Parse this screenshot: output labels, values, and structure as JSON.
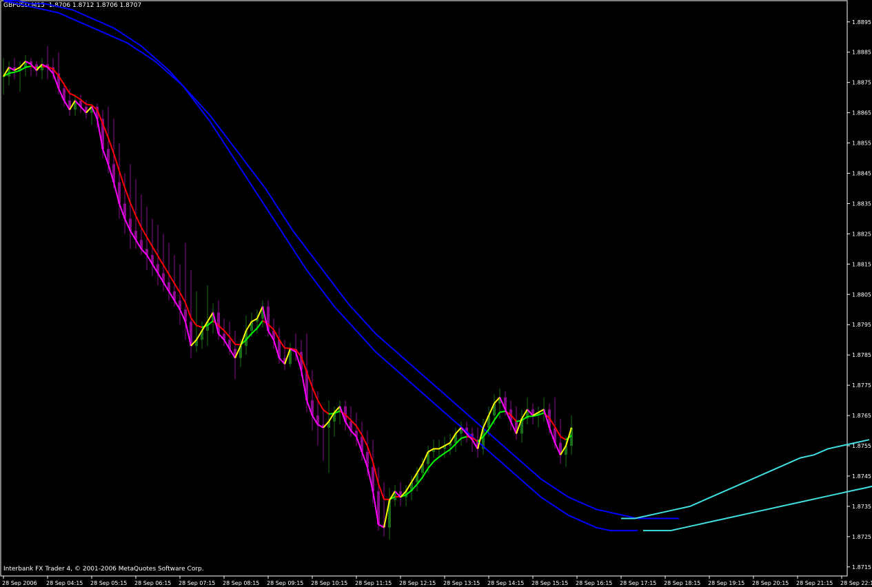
{
  "header": {
    "symbol": "GBPUSD,M15",
    "ohlc": "1.8706 1.8712 1.8706 1.8707"
  },
  "footer": {
    "copyright": "Interbank FX Trader 4, © 2001-2006 MetaQuotes Software Corp."
  },
  "colors": {
    "background": "#000000",
    "frame": "#ffffff",
    "bull_candle": "#1a6e1a",
    "bear_candle": "#8b0a8b",
    "ma_slow_primary": "#0000ff",
    "ma_slow_secondary": "#40e0e0",
    "ma_fast_down": "#ff0000",
    "ma_fast_up": "#00ff00",
    "trend_up": "#ffff00",
    "trend_down": "#ff00ff"
  },
  "chart_data": {
    "type": "line",
    "instrument": "GBPUSD",
    "timeframe": "M15",
    "ylim": [
      1.8712,
      1.8902
    ],
    "y_ticks": [
      "1.8895",
      "1.8885",
      "1.8875",
      "1.8865",
      "1.8855",
      "1.8845",
      "1.8835",
      "1.8825",
      "1.8815",
      "1.8805",
      "1.8795",
      "1.8785",
      "1.8775",
      "1.8765",
      "1.8755",
      "1.8745",
      "1.8735",
      "1.8725",
      "1.8715"
    ],
    "x_ticks": [
      {
        "bar": 0,
        "label": "28 Sep 2006"
      },
      {
        "bar": 8,
        "label": "28 Sep 04:15"
      },
      {
        "bar": 16,
        "label": "28 Sep 05:15"
      },
      {
        "bar": 24,
        "label": "28 Sep 06:15"
      },
      {
        "bar": 32,
        "label": "28 Sep 07:15"
      },
      {
        "bar": 40,
        "label": "28 Sep 08:15"
      },
      {
        "bar": 48,
        "label": "28 Sep 09:15"
      },
      {
        "bar": 56,
        "label": "28 Sep 10:15"
      },
      {
        "bar": 64,
        "label": "28 Sep 11:15"
      },
      {
        "bar": 72,
        "label": "28 Sep 12:15"
      },
      {
        "bar": 80,
        "label": "28 Sep 13:15"
      },
      {
        "bar": 88,
        "label": "28 Sep 14:15"
      },
      {
        "bar": 96,
        "label": "28 Sep 15:15"
      },
      {
        "bar": 104,
        "label": "28 Sep 16:15"
      },
      {
        "bar": 112,
        "label": "28 Sep 17:15"
      },
      {
        "bar": 120,
        "label": "28 Sep 18:15"
      },
      {
        "bar": 128,
        "label": "28 Sep 19:15"
      },
      {
        "bar": 136,
        "label": "28 Sep 20:15"
      },
      {
        "bar": 144,
        "label": "28 Sep 21:15"
      },
      {
        "bar": 152,
        "label": "28 Sep 22:15"
      }
    ],
    "candles": [
      {
        "o": 1.8877,
        "h": 1.8883,
        "l": 1.8871,
        "c": 1.8877
      },
      {
        "o": 1.8877,
        "h": 1.8882,
        "l": 1.8874,
        "c": 1.888
      },
      {
        "o": 1.888,
        "h": 1.8883,
        "l": 1.8876,
        "c": 1.8879
      },
      {
        "o": 1.8879,
        "h": 1.8882,
        "l": 1.8872,
        "c": 1.888
      },
      {
        "o": 1.888,
        "h": 1.8884,
        "l": 1.8877,
        "c": 1.8882
      },
      {
        "o": 1.8882,
        "h": 1.8883,
        "l": 1.8877,
        "c": 1.8881
      },
      {
        "o": 1.8881,
        "h": 1.8882,
        "l": 1.8877,
        "c": 1.8879
      },
      {
        "o": 1.8879,
        "h": 1.8883,
        "l": 1.8876,
        "c": 1.8881
      },
      {
        "o": 1.8881,
        "h": 1.8887,
        "l": 1.8876,
        "c": 1.888
      },
      {
        "o": 1.888,
        "h": 1.8883,
        "l": 1.8876,
        "c": 1.8878
      },
      {
        "o": 1.8878,
        "h": 1.8885,
        "l": 1.8871,
        "c": 1.8873
      },
      {
        "o": 1.8873,
        "h": 1.8875,
        "l": 1.8867,
        "c": 1.8869
      },
      {
        "o": 1.8869,
        "h": 1.8873,
        "l": 1.8864,
        "c": 1.8866
      },
      {
        "o": 1.8866,
        "h": 1.8871,
        "l": 1.8864,
        "c": 1.8869
      },
      {
        "o": 1.8869,
        "h": 1.8871,
        "l": 1.8865,
        "c": 1.8867
      },
      {
        "o": 1.8867,
        "h": 1.8869,
        "l": 1.8863,
        "c": 1.8865
      },
      {
        "o": 1.8865,
        "h": 1.8868,
        "l": 1.8861,
        "c": 1.8867
      },
      {
        "o": 1.8867,
        "h": 1.8868,
        "l": 1.886,
        "c": 1.8863
      },
      {
        "o": 1.8863,
        "h": 1.8866,
        "l": 1.885,
        "c": 1.8853
      },
      {
        "o": 1.8853,
        "h": 1.8867,
        "l": 1.8845,
        "c": 1.8848
      },
      {
        "o": 1.8848,
        "h": 1.8863,
        "l": 1.884,
        "c": 1.8842
      },
      {
        "o": 1.8842,
        "h": 1.8855,
        "l": 1.883,
        "c": 1.8835
      },
      {
        "o": 1.8835,
        "h": 1.8845,
        "l": 1.8825,
        "c": 1.883
      },
      {
        "o": 1.883,
        "h": 1.8848,
        "l": 1.882,
        "c": 1.8826
      },
      {
        "o": 1.8826,
        "h": 1.8843,
        "l": 1.882,
        "c": 1.8823
      },
      {
        "o": 1.8823,
        "h": 1.8838,
        "l": 1.8818,
        "c": 1.882
      },
      {
        "o": 1.882,
        "h": 1.8834,
        "l": 1.8813,
        "c": 1.8818
      },
      {
        "o": 1.8818,
        "h": 1.883,
        "l": 1.8811,
        "c": 1.8815
      },
      {
        "o": 1.8815,
        "h": 1.8828,
        "l": 1.8808,
        "c": 1.8812
      },
      {
        "o": 1.8812,
        "h": 1.8825,
        "l": 1.8806,
        "c": 1.8809
      },
      {
        "o": 1.8809,
        "h": 1.8822,
        "l": 1.8803,
        "c": 1.8806
      },
      {
        "o": 1.8806,
        "h": 1.8818,
        "l": 1.8801,
        "c": 1.8803
      },
      {
        "o": 1.8803,
        "h": 1.8815,
        "l": 1.8795,
        "c": 1.88
      },
      {
        "o": 1.88,
        "h": 1.8822,
        "l": 1.879,
        "c": 1.8796
      },
      {
        "o": 1.8796,
        "h": 1.8813,
        "l": 1.8784,
        "c": 1.8788
      },
      {
        "o": 1.8788,
        "h": 1.8806,
        "l": 1.8786,
        "c": 1.879
      },
      {
        "o": 1.879,
        "h": 1.8796,
        "l": 1.8787,
        "c": 1.8793
      },
      {
        "o": 1.8793,
        "h": 1.8808,
        "l": 1.8788,
        "c": 1.8796
      },
      {
        "o": 1.8796,
        "h": 1.8802,
        "l": 1.8792,
        "c": 1.8799
      },
      {
        "o": 1.8799,
        "h": 1.8803,
        "l": 1.879,
        "c": 1.8792
      },
      {
        "o": 1.8792,
        "h": 1.8797,
        "l": 1.8788,
        "c": 1.879
      },
      {
        "o": 1.879,
        "h": 1.8796,
        "l": 1.8785,
        "c": 1.8787
      },
      {
        "o": 1.8787,
        "h": 1.8793,
        "l": 1.8777,
        "c": 1.8784
      },
      {
        "o": 1.8784,
        "h": 1.879,
        "l": 1.8781,
        "c": 1.8788
      },
      {
        "o": 1.8788,
        "h": 1.8798,
        "l": 1.8785,
        "c": 1.8793
      },
      {
        "o": 1.8793,
        "h": 1.8799,
        "l": 1.8791,
        "c": 1.8796
      },
      {
        "o": 1.8796,
        "h": 1.88,
        "l": 1.8792,
        "c": 1.8797
      },
      {
        "o": 1.8797,
        "h": 1.8803,
        "l": 1.8794,
        "c": 1.8801
      },
      {
        "o": 1.8801,
        "h": 1.8803,
        "l": 1.8791,
        "c": 1.8793
      },
      {
        "o": 1.8793,
        "h": 1.8797,
        "l": 1.8787,
        "c": 1.879
      },
      {
        "o": 1.879,
        "h": 1.8794,
        "l": 1.8782,
        "c": 1.8784
      },
      {
        "o": 1.8784,
        "h": 1.879,
        "l": 1.878,
        "c": 1.8782
      },
      {
        "o": 1.8782,
        "h": 1.8789,
        "l": 1.8781,
        "c": 1.8787
      },
      {
        "o": 1.8787,
        "h": 1.8792,
        "l": 1.8783,
        "c": 1.8786
      },
      {
        "o": 1.8786,
        "h": 1.879,
        "l": 1.8778,
        "c": 1.878
      },
      {
        "o": 1.878,
        "h": 1.8792,
        "l": 1.8766,
        "c": 1.877
      },
      {
        "o": 1.877,
        "h": 1.878,
        "l": 1.876,
        "c": 1.8765
      },
      {
        "o": 1.8765,
        "h": 1.8773,
        "l": 1.8755,
        "c": 1.8762
      },
      {
        "o": 1.8762,
        "h": 1.8767,
        "l": 1.875,
        "c": 1.8761
      },
      {
        "o": 1.8761,
        "h": 1.877,
        "l": 1.8746,
        "c": 1.8763
      },
      {
        "o": 1.8763,
        "h": 1.8768,
        "l": 1.8758,
        "c": 1.8766
      },
      {
        "o": 1.8766,
        "h": 1.877,
        "l": 1.8762,
        "c": 1.8768
      },
      {
        "o": 1.8768,
        "h": 1.877,
        "l": 1.876,
        "c": 1.8763
      },
      {
        "o": 1.8763,
        "h": 1.8768,
        "l": 1.8758,
        "c": 1.876
      },
      {
        "o": 1.876,
        "h": 1.8766,
        "l": 1.8755,
        "c": 1.8758
      },
      {
        "o": 1.8758,
        "h": 1.8763,
        "l": 1.875,
        "c": 1.8753
      },
      {
        "o": 1.8753,
        "h": 1.876,
        "l": 1.8745,
        "c": 1.8748
      },
      {
        "o": 1.8748,
        "h": 1.8757,
        "l": 1.8736,
        "c": 1.874
      },
      {
        "o": 1.874,
        "h": 1.8748,
        "l": 1.8727,
        "c": 1.8729
      },
      {
        "o": 1.8729,
        "h": 1.8743,
        "l": 1.8725,
        "c": 1.8728
      },
      {
        "o": 1.8728,
        "h": 1.8741,
        "l": 1.8724,
        "c": 1.8737
      },
      {
        "o": 1.8737,
        "h": 1.8742,
        "l": 1.8735,
        "c": 1.874
      },
      {
        "o": 1.874,
        "h": 1.8743,
        "l": 1.8735,
        "c": 1.8738
      },
      {
        "o": 1.8738,
        "h": 1.8742,
        "l": 1.8735,
        "c": 1.874
      },
      {
        "o": 1.874,
        "h": 1.8745,
        "l": 1.8737,
        "c": 1.8743
      },
      {
        "o": 1.8743,
        "h": 1.8748,
        "l": 1.874,
        "c": 1.8746
      },
      {
        "o": 1.8746,
        "h": 1.8751,
        "l": 1.8744,
        "c": 1.8749
      },
      {
        "o": 1.8749,
        "h": 1.8755,
        "l": 1.8746,
        "c": 1.8753
      },
      {
        "o": 1.8753,
        "h": 1.8757,
        "l": 1.8751,
        "c": 1.8754
      },
      {
        "o": 1.8754,
        "h": 1.8757,
        "l": 1.8751,
        "c": 1.8754
      },
      {
        "o": 1.8754,
        "h": 1.8758,
        "l": 1.8751,
        "c": 1.8755
      },
      {
        "o": 1.8755,
        "h": 1.8759,
        "l": 1.8752,
        "c": 1.8756
      },
      {
        "o": 1.8756,
        "h": 1.8761,
        "l": 1.8753,
        "c": 1.8759
      },
      {
        "o": 1.8759,
        "h": 1.8763,
        "l": 1.8755,
        "c": 1.8761
      },
      {
        "o": 1.8761,
        "h": 1.8763,
        "l": 1.8756,
        "c": 1.8759
      },
      {
        "o": 1.8759,
        "h": 1.8761,
        "l": 1.8753,
        "c": 1.8757
      },
      {
        "o": 1.8757,
        "h": 1.8761,
        "l": 1.8751,
        "c": 1.8754
      },
      {
        "o": 1.8754,
        "h": 1.8764,
        "l": 1.8752,
        "c": 1.8761
      },
      {
        "o": 1.8761,
        "h": 1.8768,
        "l": 1.8758,
        "c": 1.8765
      },
      {
        "o": 1.8765,
        "h": 1.8772,
        "l": 1.8762,
        "c": 1.8769
      },
      {
        "o": 1.8769,
        "h": 1.8774,
        "l": 1.8764,
        "c": 1.8771
      },
      {
        "o": 1.8771,
        "h": 1.8773,
        "l": 1.8765,
        "c": 1.8767
      },
      {
        "o": 1.8767,
        "h": 1.877,
        "l": 1.876,
        "c": 1.8763
      },
      {
        "o": 1.8763,
        "h": 1.8768,
        "l": 1.8757,
        "c": 1.8759
      },
      {
        "o": 1.8759,
        "h": 1.8767,
        "l": 1.8756,
        "c": 1.8764
      },
      {
        "o": 1.8764,
        "h": 1.8771,
        "l": 1.8762,
        "c": 1.8767
      },
      {
        "o": 1.8767,
        "h": 1.8769,
        "l": 1.8762,
        "c": 1.8765
      },
      {
        "o": 1.8765,
        "h": 1.8768,
        "l": 1.8761,
        "c": 1.8766
      },
      {
        "o": 1.8766,
        "h": 1.8771,
        "l": 1.8763,
        "c": 1.8767
      },
      {
        "o": 1.8767,
        "h": 1.8769,
        "l": 1.8759,
        "c": 1.8761
      },
      {
        "o": 1.8761,
        "h": 1.8771,
        "l": 1.8754,
        "c": 1.8756
      },
      {
        "o": 1.8756,
        "h": 1.8764,
        "l": 1.8749,
        "c": 1.8752
      },
      {
        "o": 1.8752,
        "h": 1.8758,
        "l": 1.8748,
        "c": 1.8755
      },
      {
        "o": 1.8755,
        "h": 1.8765,
        "l": 1.8752,
        "c": 1.8761
      }
    ],
    "series": [
      {
        "type": "line",
        "color": "#0000ff",
        "values": [
          1.8902,
          1.8901,
          1.89,
          1.8899,
          1.8898,
          1.8896,
          1.8894,
          1.8892,
          1.889,
          1.8888,
          1.8885,
          1.8882,
          1.8878,
          1.8874,
          1.8869,
          1.8864,
          1.8858,
          1.8852,
          1.8846,
          1.884,
          1.8833,
          1.8826,
          1.882,
          1.8814,
          1.8808,
          1.8802,
          1.8797,
          1.8792,
          1.8788,
          1.8784,
          1.878,
          1.8776,
          1.8772,
          1.8768,
          1.8764,
          1.876,
          1.8756,
          1.8752,
          1.8748,
          1.8744,
          1.8741,
          1.8738,
          1.8736,
          1.8734,
          1.8733,
          1.8732,
          1.8731,
          1.8731,
          1.8731,
          1.8731
        ]
      },
      {
        "type": "line",
        "color": "#0000ff",
        "values": [
          1.8902,
          1.8902,
          1.8901,
          1.8901,
          1.89,
          1.8899,
          1.8897,
          1.8895,
          1.8893,
          1.889,
          1.8887,
          1.8883,
          1.8879,
          1.8874,
          1.8868,
          1.8862,
          1.8855,
          1.8848,
          1.8841,
          1.8834,
          1.8827,
          1.882,
          1.8813,
          1.8807,
          1.8801,
          1.8796,
          1.8791,
          1.8786,
          1.8782,
          1.8778,
          1.8774,
          1.877,
          1.8766,
          1.8762,
          1.8758,
          1.8754,
          1.875,
          1.8746,
          1.8742,
          1.8738,
          1.8735,
          1.8732,
          1.873,
          1.8728,
          1.8727,
          1.8727,
          1.8727
        ]
      },
      {
        "type": "line",
        "color": "#40e0e0",
        "values": [
          1.8731,
          1.8731,
          1.8732,
          1.8733,
          1.8734,
          1.8735,
          1.8737,
          1.8739,
          1.8741,
          1.8743,
          1.8745,
          1.8747,
          1.8749,
          1.8751,
          1.8752,
          1.8754,
          1.8755,
          1.8756,
          1.8757
        ]
      },
      {
        "type": "line",
        "color": "#40e0e0",
        "values": [
          1.8727,
          1.8727,
          1.8727,
          1.8728,
          1.8729,
          1.873,
          1.8731,
          1.8732,
          1.8733,
          1.8734,
          1.8735,
          1.8736,
          1.8737,
          1.8738,
          1.8739,
          1.874,
          1.8741,
          1.8742,
          1.8743,
          1.8744
        ]
      }
    ]
  }
}
